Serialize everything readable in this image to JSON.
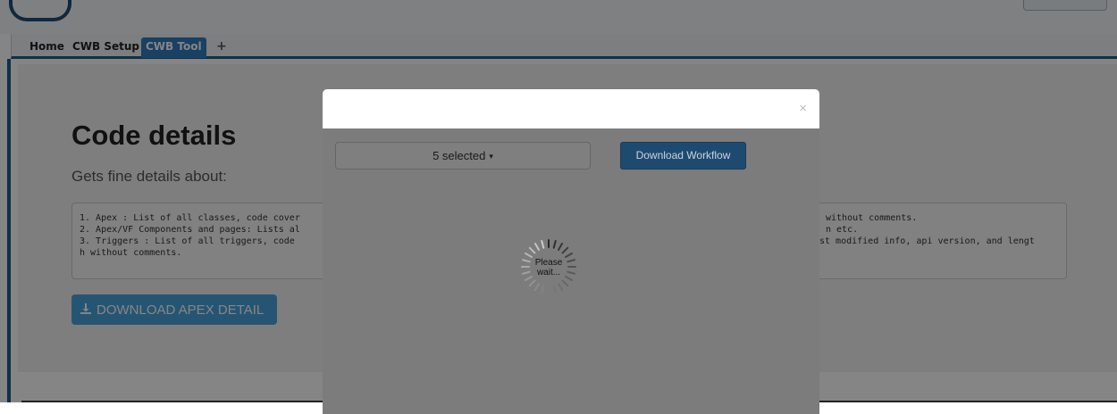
{
  "tabs": [
    {
      "label": "Home"
    },
    {
      "label": "CWB Setup"
    },
    {
      "label": "CWB Tool",
      "active": true
    },
    {
      "label": "+"
    }
  ],
  "page": {
    "title": "Code details",
    "lead": "Gets fine details about:",
    "details_lines": [
      "1. Apex : List of all classes, code cover",
      "without comments.",
      "2. Apex/VF Components and pages: Lists al",
      "n etc.",
      "3. Triggers : List of all triggers, code",
      "st modified info, api version, and lengt",
      "h without comments."
    ],
    "download_apex_label": "DOWNLOAD APEX DETAIL",
    "download_apex_icon": "download-icon"
  },
  "modal": {
    "close_glyph": "×",
    "select_label": "5 selected",
    "select_caret": "▾",
    "download_workflow_label": "Download Workflow",
    "spinner_text_1": "Please",
    "spinner_text_2": "wait..."
  },
  "colors": {
    "accent": "#2f7dbf",
    "primary_button": "#4aa3df",
    "workflow_button": "#1f4a70",
    "nav_rule": "#1a5f8a"
  }
}
